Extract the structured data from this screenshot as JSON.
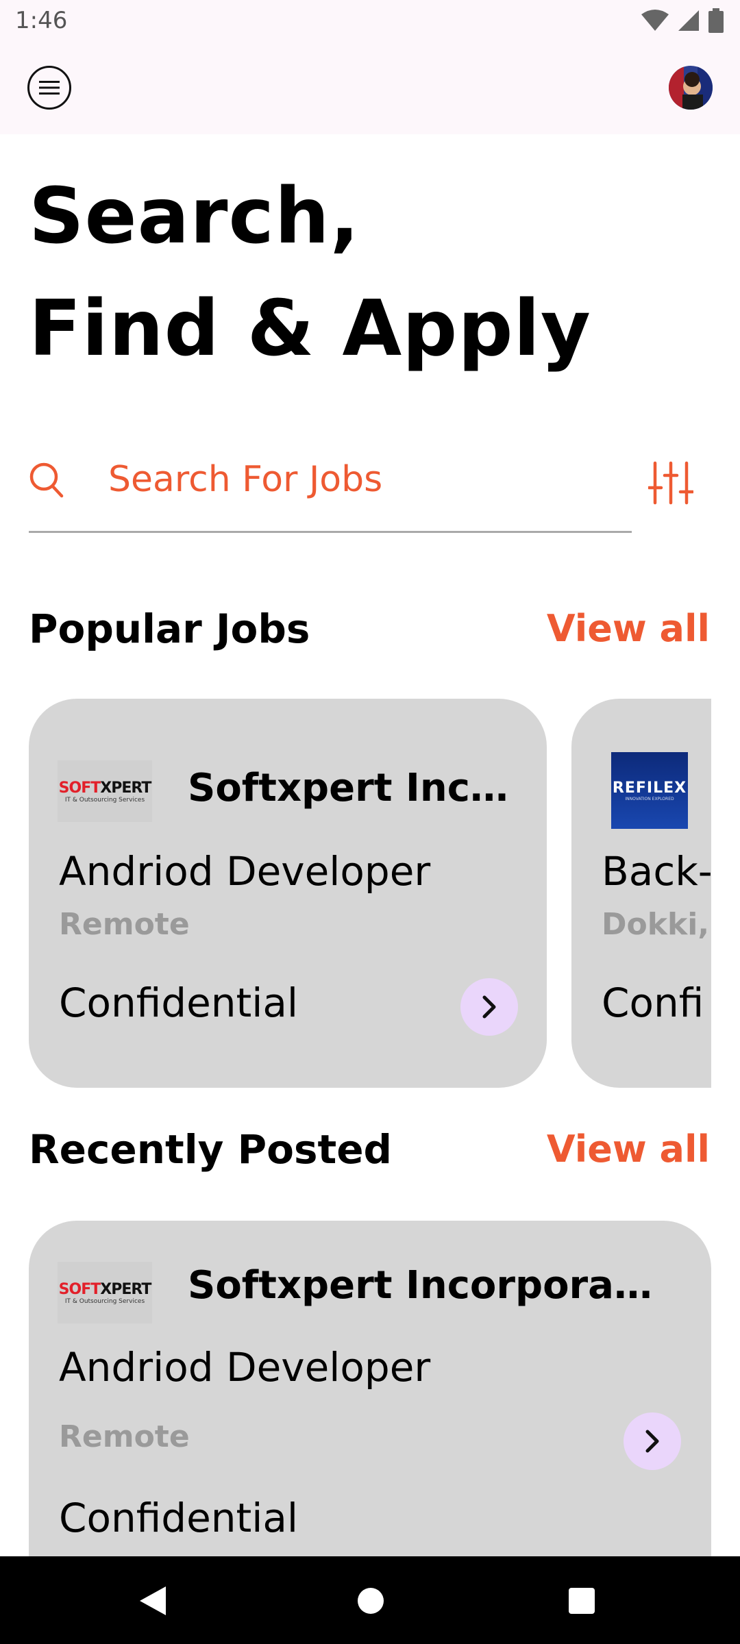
{
  "status_bar": {
    "time": "1:46"
  },
  "header": {
    "headline_line1": "Search,",
    "headline_line2": "Find & Apply"
  },
  "search": {
    "placeholder": "Search For Jobs"
  },
  "popular": {
    "title": "Popular Jobs",
    "view_all": "View all",
    "jobs": [
      {
        "logo_text": "SOFTXPERT",
        "logo_tagline": "IT & Outsourcing Services",
        "company": "Softxpert Inc…",
        "title": "Andriod Developer",
        "location": "Remote",
        "salary": "Confidential"
      },
      {
        "logo_text": "REFILEX",
        "logo_tagline": "INNOVATION EXPLORED",
        "company": "",
        "title": "Back-",
        "location": "Dokki, (",
        "salary": "Confi"
      }
    ]
  },
  "recent": {
    "title": "Recently Posted",
    "view_all": "View all",
    "jobs": [
      {
        "logo_text": "SOFTXPERT",
        "logo_tagline": "IT & Outsourcing Services",
        "company": "Softxpert Incorpora…",
        "title": "Andriod Developer",
        "location": "Remote",
        "salary": "Confidential"
      }
    ]
  },
  "colors": {
    "accent": "#ee5a32",
    "card_bg": "#d6d6d6",
    "button_bg": "#ead6fb",
    "appbar_bg": "#fdf7fb"
  }
}
